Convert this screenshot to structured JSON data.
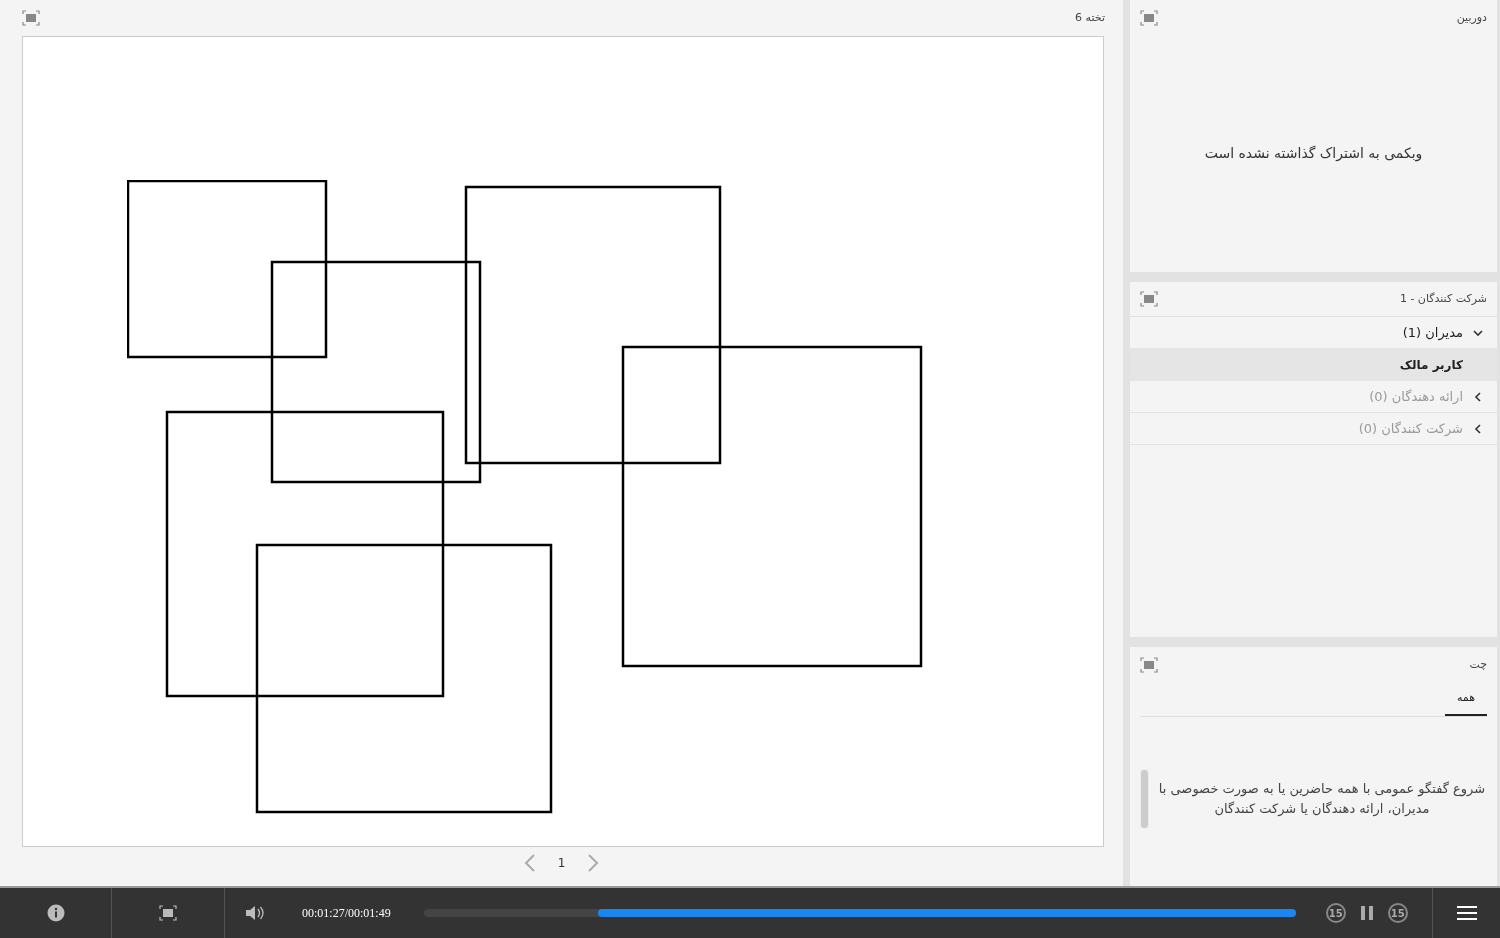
{
  "whiteboard": {
    "title": "تخته 6",
    "page": "1"
  },
  "camera": {
    "title": "دوربین",
    "message": "وبکمی به اشتراک گذاشته نشده است"
  },
  "attendees": {
    "title": "شرکت کنندگان - 1",
    "groups": [
      {
        "label": "مدیران (1)",
        "expanded": true,
        "disabled": false,
        "members": [
          {
            "name": "کاربر مالک",
            "selected": true
          }
        ]
      },
      {
        "label": "ارائه دهندگان (0)",
        "expanded": false,
        "disabled": true
      },
      {
        "label": "شرکت کنندگان (0)",
        "expanded": false,
        "disabled": true
      }
    ]
  },
  "chat": {
    "title": "چت",
    "tabs": [
      {
        "label": "همه",
        "selected": true
      }
    ],
    "message": "شروع گفتگو عمومی با همه حاضرین یا به صورت خصوصی با مدیران، ارائه دهندگان یا شرکت کنندگان"
  },
  "player": {
    "time": "00:01:27/00:01:49",
    "level": 0.8,
    "playing": true,
    "skip_back": "15",
    "skip_forward": "15"
  }
}
